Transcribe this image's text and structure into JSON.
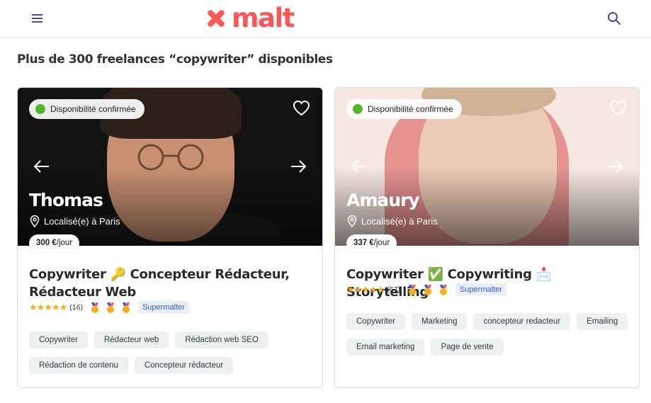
{
  "header": {
    "logo_text": "malt",
    "brand_color": "#fc5757"
  },
  "results": {
    "heading": "Plus de 300 freelances “copywriter” disponibles"
  },
  "cards": [
    {
      "availability": "Disponibilité confirmée",
      "name": "Thomas",
      "location": "Localisé(e) à Paris",
      "rate_value": "300 €",
      "rate_unit": "/jour",
      "title": "Copywriter 🔑 Concepteur Rédacteur, Rédacteur Web",
      "stars": "★★★★★",
      "rating": 5,
      "review_count": "(16)",
      "supermalter": "Supermalter",
      "tags": [
        "Copywriter",
        "Rédacteur web",
        "Rédaction web SEO",
        "Rédaction de contenu",
        "Concepteur rédacteur"
      ]
    },
    {
      "availability": "Disponibilité confirmée",
      "name": "Amaury",
      "location": "Localisé(e) à Paris",
      "rate_value": "337 €",
      "rate_unit": "/jour",
      "title": "Copywriter ✅ Copywriting 📩 Storytelling",
      "stars": "★★★★★",
      "rating": 5,
      "review_count": "(57)",
      "supermalter": "Supermalter",
      "tags": [
        "Copywriter",
        "Marketing",
        "concepteur redacteur",
        "Emailing",
        "Email marketing",
        "Page de vente"
      ]
    }
  ],
  "icons": {
    "menu": "hamburger-menu-icon",
    "search": "search-icon",
    "favorite": "heart-icon",
    "prev": "arrow-left-icon",
    "next": "arrow-right-icon",
    "location": "location-pin-icon",
    "medal": "medal-icon"
  },
  "colors": {
    "availability_dot": "#55b62c",
    "stars": "#f2ae1c",
    "supermalter_text": "#2e59d9",
    "supermalter_bg": "#eaf0fb",
    "tag_bg": "#edf1f2"
  }
}
